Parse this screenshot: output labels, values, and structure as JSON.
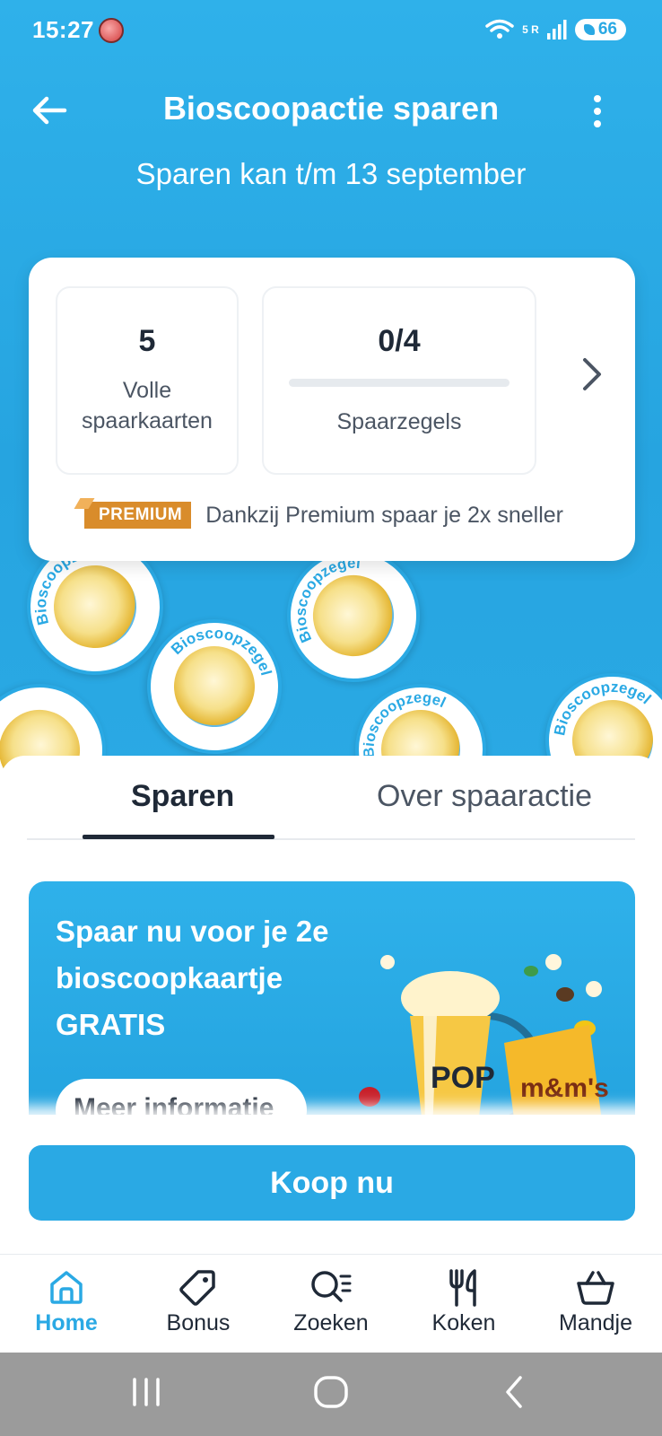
{
  "status_bar": {
    "time": "15:27",
    "network": "5 R",
    "battery": "66"
  },
  "header": {
    "title": "Bioscoopactie sparen",
    "subtitle": "Sparen kan t/m 13 september"
  },
  "card": {
    "full_cards_value": "5",
    "full_cards_label": "Volle spaarkaarten",
    "stamps_value": "0/4",
    "stamps_label": "Spaarzegels",
    "stamps_progress": 0,
    "premium_badge": "PREMIUM",
    "premium_text": "Dankzij Premium spaar je 2x sneller"
  },
  "stickers": {
    "text": "Bioscoopzegel",
    "brand": "POP"
  },
  "tabs": [
    {
      "label": "Sparen",
      "active": true
    },
    {
      "label": "Over spaaractie",
      "active": false
    }
  ],
  "promo": {
    "title": "Spaar nu voor je 2e bioscoopkaartje GRATIS",
    "button": "Meer informatie"
  },
  "action": {
    "buy_label": "Koop nu"
  },
  "bottom_nav": [
    {
      "label": "Home",
      "icon": "home-icon",
      "active": true
    },
    {
      "label": "Bonus",
      "icon": "tag-icon",
      "active": false
    },
    {
      "label": "Zoeken",
      "icon": "search-list-icon",
      "active": false
    },
    {
      "label": "Koken",
      "icon": "fork-knife-icon",
      "active": false
    },
    {
      "label": "Mandje",
      "icon": "basket-icon",
      "active": false
    }
  ],
  "colors": {
    "brand_blue": "#2AA9E4",
    "premium_orange": "#D98C2B",
    "text_dark": "#1F2937"
  }
}
